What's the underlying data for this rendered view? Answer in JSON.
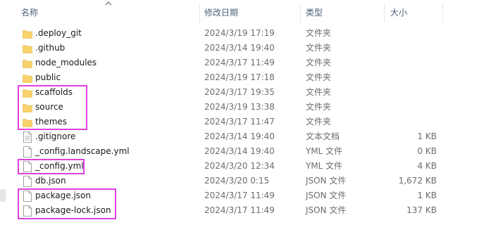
{
  "columns": {
    "name": "名称",
    "modified": "修改日期",
    "type": "类型",
    "size": "大小"
  },
  "files": [
    {
      "name": ".deploy_git",
      "modified": "2024/3/19 17:19",
      "type": "文件夹",
      "size": "",
      "kind": "folder"
    },
    {
      "name": ".github",
      "modified": "2024/3/14 19:40",
      "type": "文件夹",
      "size": "",
      "kind": "folder"
    },
    {
      "name": "node_modules",
      "modified": "2024/3/17 11:49",
      "type": "文件夹",
      "size": "",
      "kind": "folder"
    },
    {
      "name": "public",
      "modified": "2024/3/19 17:18",
      "type": "文件夹",
      "size": "",
      "kind": "folder"
    },
    {
      "name": "scaffolds",
      "modified": "2024/3/17 19:35",
      "type": "文件夹",
      "size": "",
      "kind": "folder"
    },
    {
      "name": "source",
      "modified": "2024/3/19 13:38",
      "type": "文件夹",
      "size": "",
      "kind": "folder"
    },
    {
      "name": "themes",
      "modified": "2024/3/17 11:47",
      "type": "文件夹",
      "size": "",
      "kind": "folder"
    },
    {
      "name": ".gitignore",
      "modified": "2024/3/14 19:40",
      "type": "文本文档",
      "size": "1 KB",
      "kind": "text"
    },
    {
      "name": "_config.landscape.yml",
      "modified": "2024/3/14 19:40",
      "type": "YML 文件",
      "size": "0 KB",
      "kind": "file"
    },
    {
      "name": "_config.yml",
      "modified": "2024/3/20 12:34",
      "type": "YML 文件",
      "size": "4 KB",
      "kind": "file"
    },
    {
      "name": "db.json",
      "modified": "2024/3/20 0:15",
      "type": "JSON 文件",
      "size": "1,672 KB",
      "kind": "file"
    },
    {
      "name": "package.json",
      "modified": "2024/3/17 11:49",
      "type": "JSON 文件",
      "size": "1 KB",
      "kind": "file"
    },
    {
      "name": "package-lock.json",
      "modified": "2024/3/17 11:49",
      "type": "JSON 文件",
      "size": "137 KB",
      "kind": "file"
    }
  ],
  "colors": {
    "folder": "#f8d26a",
    "highlight": "#e040e0",
    "header_text": "#4c607a",
    "meta_text": "#6d6d6d"
  },
  "sort": {
    "column": "name",
    "icon": "sort-ascending-icon"
  }
}
